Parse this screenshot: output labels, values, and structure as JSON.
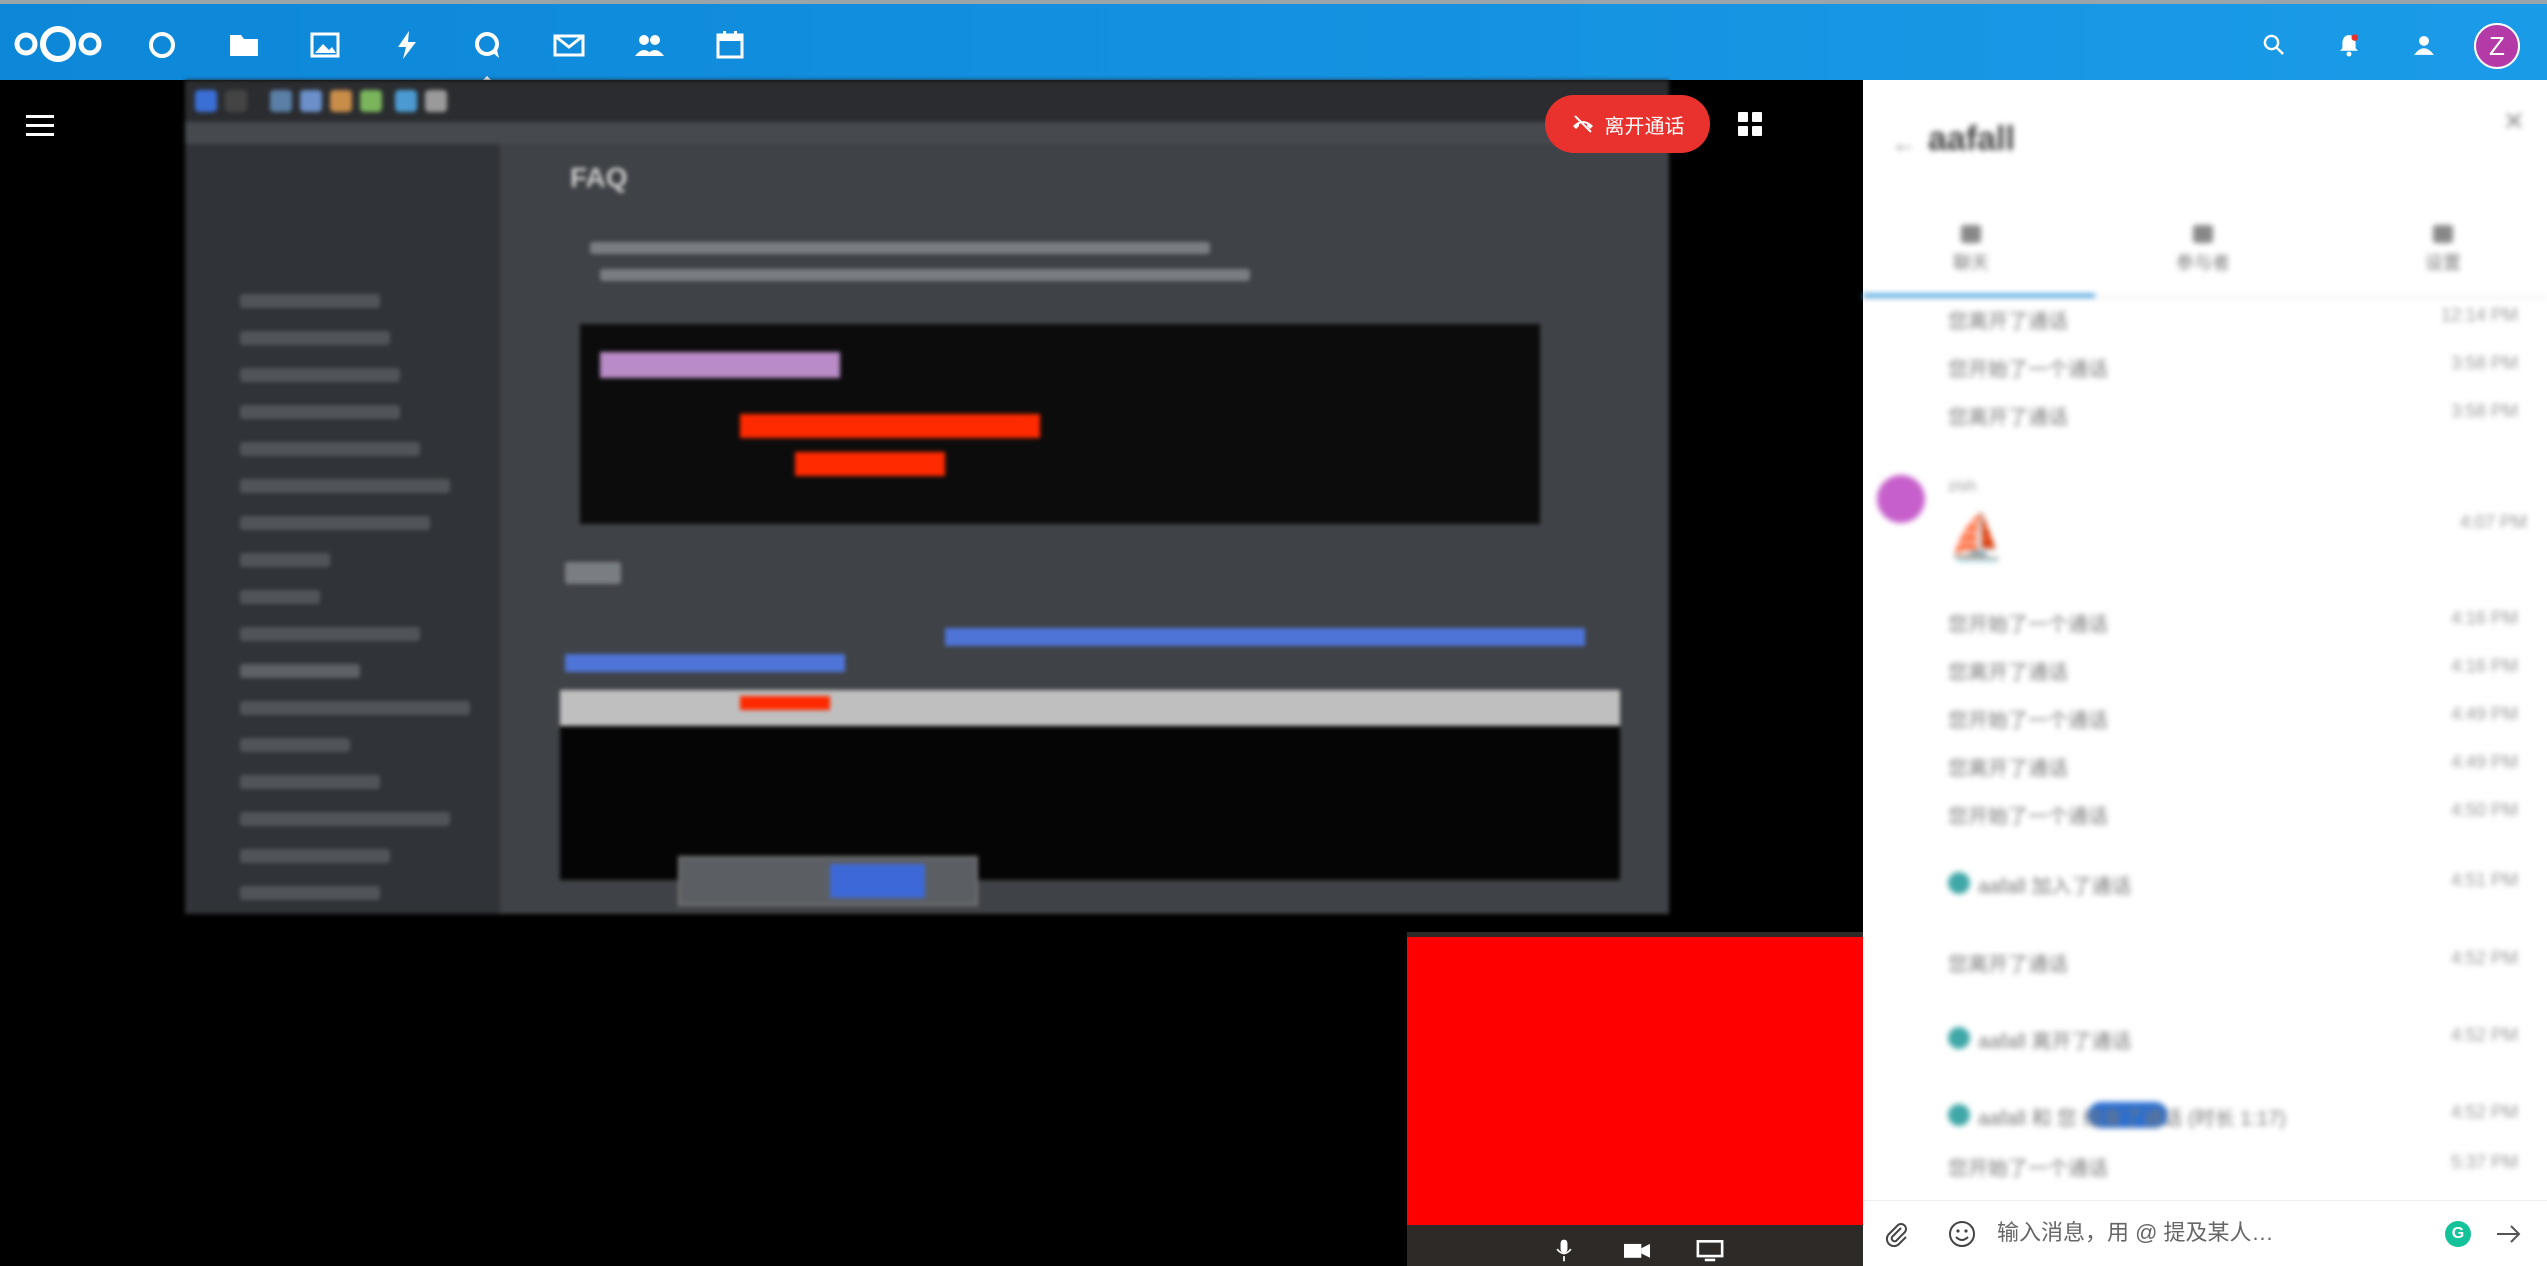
{
  "header": {
    "apps": [
      {
        "name": "dashboard",
        "icon": "circle-icon"
      },
      {
        "name": "files",
        "icon": "folder-icon"
      },
      {
        "name": "photos",
        "icon": "image-icon"
      },
      {
        "name": "activity",
        "icon": "lightning-icon"
      },
      {
        "name": "talk",
        "icon": "talk-icon",
        "active": true
      },
      {
        "name": "mail",
        "icon": "mail-icon"
      },
      {
        "name": "contacts",
        "icon": "contacts-icon"
      },
      {
        "name": "calendar",
        "icon": "calendar-icon"
      }
    ],
    "avatar_initial": "Z",
    "brand_color": "#0d87d8"
  },
  "call": {
    "leave_label": "离开通话",
    "leave_color": "#e9322d",
    "screenshare": {
      "heading_faq": "FAQ"
    }
  },
  "chat": {
    "title": "aafall",
    "tabs": [
      {
        "label": "聊天"
      },
      {
        "label": "参与者"
      },
      {
        "label": "设置"
      }
    ],
    "messages": [
      {
        "text": "您离开了通话",
        "time": "12:14 PM"
      },
      {
        "text": "您开始了一个通话",
        "time": "3:58 PM"
      },
      {
        "text": "您离开了通话",
        "time": "3:58 PM"
      },
      {
        "text": "您开始了一个通话",
        "time": "4:16 PM"
      },
      {
        "text": "您离开了通话",
        "time": "4:16 PM"
      },
      {
        "text": "您开始了一个通话",
        "time": "4:49 PM"
      },
      {
        "text": "您离开了通话",
        "time": "4:49 PM"
      },
      {
        "text": "您开始了一个通话",
        "time": "4:50 PM"
      },
      {
        "text": "aafall 加入了通话",
        "time": "4:51 PM"
      },
      {
        "text": "您离开了通话",
        "time": "4:52 PM"
      },
      {
        "text": "aafall 离开了通话",
        "time": "4:52 PM"
      },
      {
        "text": "aafall 和 您 结束了通话 (时长 1:17)",
        "time": "4:52 PM"
      },
      {
        "text": "您开始了一个通话",
        "time": "5:37 PM"
      }
    ],
    "emoji_message": {
      "author": "zish",
      "emoji": "⛵",
      "time": "4:07 PM"
    },
    "composer": {
      "placeholder": "输入消息，用 @ 提及某人…",
      "grammarly": "G"
    }
  }
}
